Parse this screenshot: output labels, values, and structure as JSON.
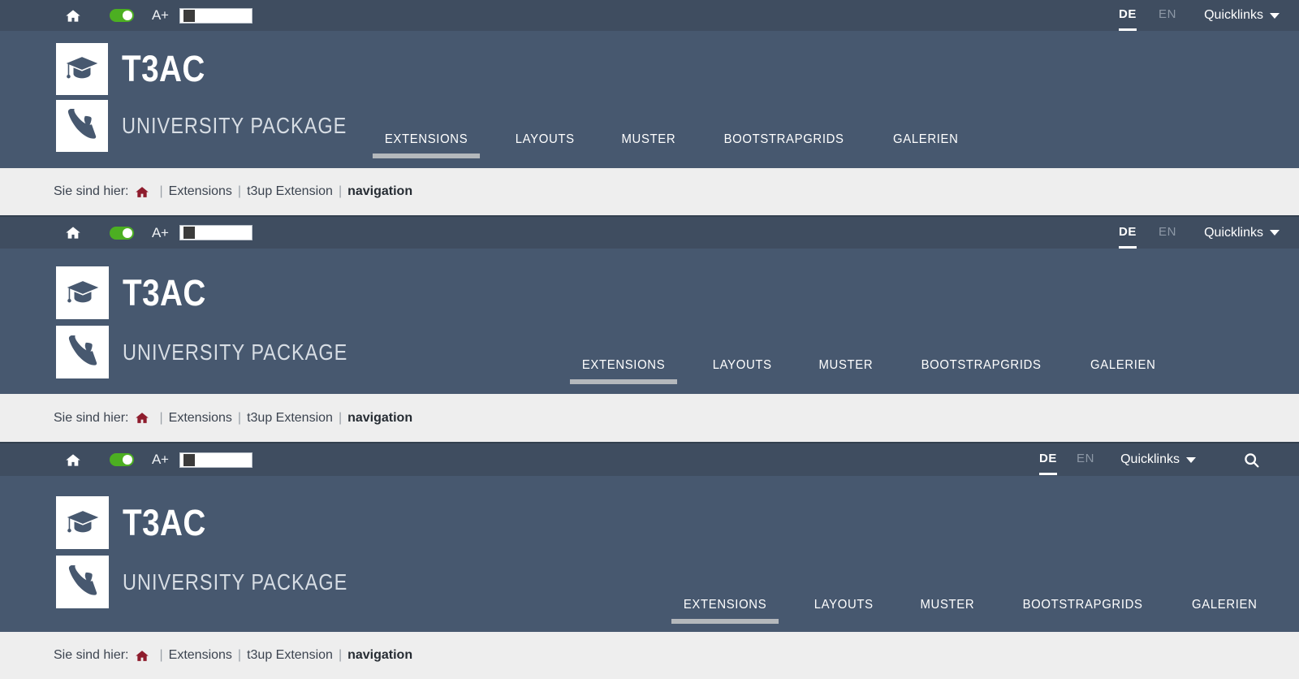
{
  "site": {
    "brand_title": "T3AC",
    "brand_subtitle": "UNIVERSITY PACKAGE"
  },
  "topbar": {
    "home_icon": "home-icon",
    "contrast_toggle_state": "on",
    "font_size_label": "A+",
    "font_size_slider_value": 0,
    "lang_de": "DE",
    "lang_en": "EN",
    "lang_active": "DE",
    "quicklinks_label": "Quicklinks",
    "quicklinks_caret": "chevron-down-icon",
    "search_icon": "search-icon"
  },
  "nav": {
    "items": [
      {
        "label": "EXTENSIONS",
        "active": true
      },
      {
        "label": "LAYOUTS",
        "active": false
      },
      {
        "label": "MUSTER",
        "active": false
      },
      {
        "label": "BOOTSTRAPGRIDS",
        "active": false
      },
      {
        "label": "GALERIEN",
        "active": false
      }
    ]
  },
  "breadcrumb": {
    "prefix": "Sie sind hier:",
    "home_icon": "home-icon",
    "separator": "|",
    "items": [
      {
        "label": "Extensions",
        "current": false
      },
      {
        "label": "t3up Extension",
        "current": false
      },
      {
        "label": "navigation",
        "current": true
      }
    ]
  },
  "colors": {
    "topbar_bg": "#3f4d60",
    "header_bg": "#47586f",
    "breadcrumb_bg": "#eeeeee",
    "toggle_on": "#4caf22",
    "active_underline": "#b4b8bc",
    "home_red": "#8e1c2d"
  },
  "variants": [
    {
      "id": "v1",
      "nav_align": "left-offset"
    },
    {
      "id": "v2",
      "nav_align": "center"
    },
    {
      "id": "v3",
      "nav_align": "right"
    }
  ]
}
